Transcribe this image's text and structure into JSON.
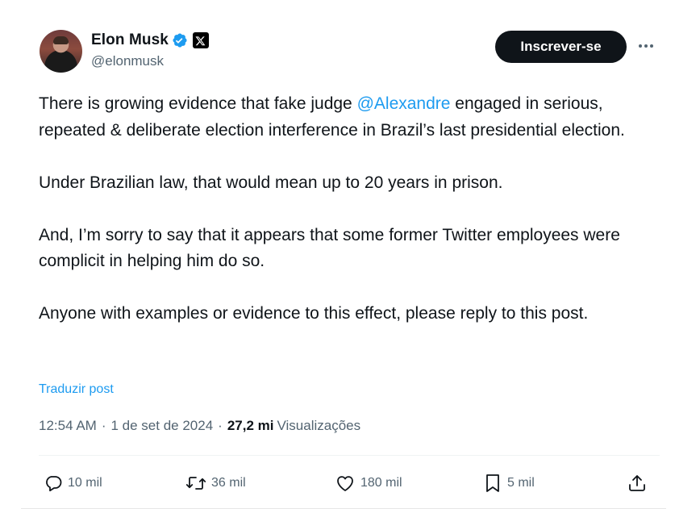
{
  "author": {
    "display_name": "Elon Musk",
    "handle": "@elonmusk",
    "verified_badge_icon": "verified-badge-icon",
    "affiliation_icon": "x-logo-icon"
  },
  "header": {
    "subscribe_label": "Inscrever-se",
    "more_icon": "more-horizontal-icon"
  },
  "tweet": {
    "paragraph1_before": "There is growing evidence that fake judge ",
    "mention": "@Alexandre",
    "paragraph1_after": " engaged in serious, repeated & deliberate election interference in Brazil’s last presidential election.",
    "paragraph2": "Under Brazilian law, that would mean up to 20 years in prison.",
    "paragraph3": "And, I’m sorry to say that it appears that some former Twitter employees were complicit in helping him do so.",
    "paragraph4": "Anyone with examples or evidence to this effect, please reply to this post.",
    "translate_label": "Traduzir post"
  },
  "meta": {
    "time": "12:54 AM",
    "separator": "·",
    "date": "1 de set de 2024",
    "views_count": "27,2 mi",
    "views_label": "Visualizações"
  },
  "actions": {
    "reply": "10 mil",
    "retweet": "36 mil",
    "like": "180 mil",
    "bookmark": "5 mil"
  },
  "colors": {
    "text": "#0f1419",
    "secondary": "#536471",
    "link": "#1d9bf0",
    "button_bg": "#0f1419"
  }
}
